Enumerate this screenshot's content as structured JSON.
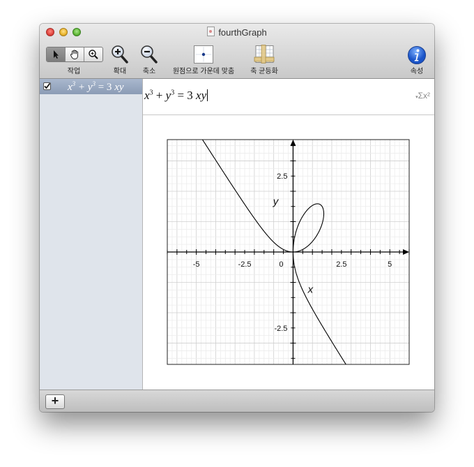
{
  "window": {
    "title": "fourthGraph"
  },
  "toolbar": {
    "mode_label": "작업",
    "zoom_in_label": "확대",
    "zoom_out_label": "축소",
    "center_origin_label": "원점으로 가운데 맞춤",
    "equalize_axes_label": "축 균등화",
    "inspector_label": "속성"
  },
  "equations": [
    {
      "lhs": "x",
      "plus": "+",
      "rhs": "y",
      "eq": "= 3",
      "vars": "xy",
      "exp": "3",
      "checked": true
    }
  ],
  "editor": {
    "lhs": "x",
    "plus": "+",
    "rhs": "y",
    "eq": "= 3",
    "vars": "xy",
    "exp": "3",
    "sigma_icon": "Σx²"
  },
  "chart_data": {
    "type": "line",
    "equation": "x^3 + y^3 = 3xy",
    "xlabel": "x",
    "ylabel": "y",
    "xlim": [
      -6.5,
      6
    ],
    "ylim": [
      -3.7,
      3.7
    ],
    "x_ticks": [
      "-5",
      "-2.5",
      "0",
      "2.5",
      "5"
    ],
    "y_ticks": [
      "2.5",
      "-2.5"
    ],
    "grid": true
  },
  "statusbar": {
    "add_label": "+"
  }
}
